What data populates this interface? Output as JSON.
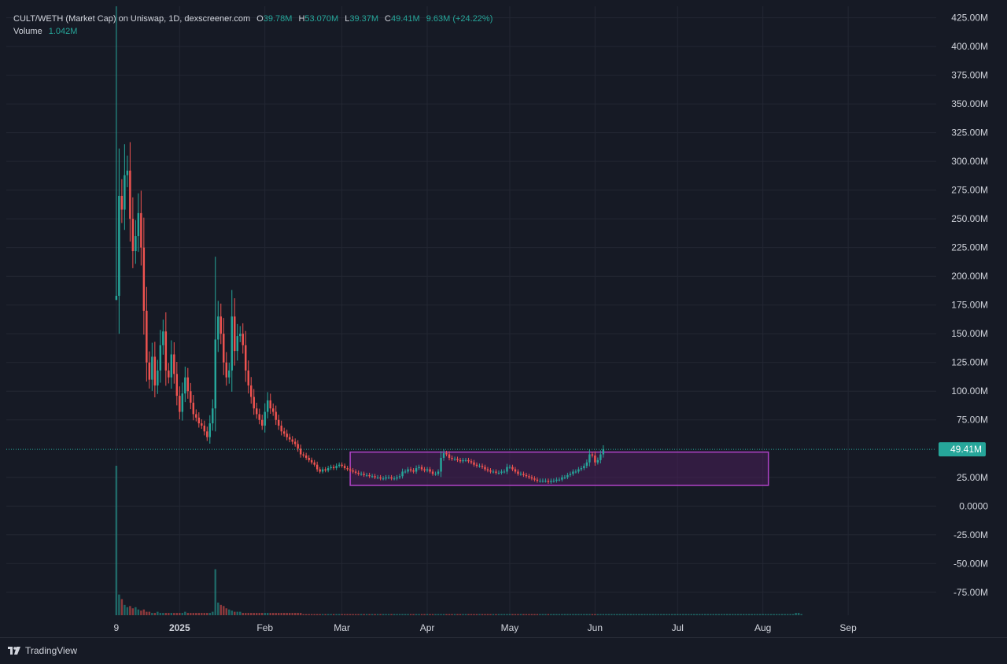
{
  "legend": {
    "title": "CULT/WETH (Market Cap) on Uniswap, 1D, dexscreener.com",
    "o_label": "O",
    "o_value": "39.78M",
    "h_label": "H",
    "h_value": "53.070M",
    "l_label": "L",
    "l_value": "39.37M",
    "c_label": "C",
    "c_value": "49.41M",
    "change": "9.63M (+24.22%)",
    "volume_label": "Volume",
    "volume_value": "1.042M"
  },
  "brand": "TradingView",
  "colors": {
    "background": "#161a25",
    "grid": "#232733",
    "up": "#26a69a",
    "down": "#ef5350",
    "box_fill": "#4a1f5a",
    "box_stroke": "#b042c6",
    "price_line": "#26a69a"
  },
  "chart_data": {
    "type": "candlestick",
    "timeframe": "1D",
    "y_unit": "market cap (USD)",
    "ylim": [
      -95,
      435
    ],
    "y_ticks": [
      {
        "v": 425,
        "label": "425.00M"
      },
      {
        "v": 400,
        "label": "400.00M"
      },
      {
        "v": 375,
        "label": "375.00M"
      },
      {
        "v": 350,
        "label": "350.00M"
      },
      {
        "v": 325,
        "label": "325.00M"
      },
      {
        "v": 300,
        "label": "300.00M"
      },
      {
        "v": 275,
        "label": "275.00M"
      },
      {
        "v": 250,
        "label": "250.00M"
      },
      {
        "v": 225,
        "label": "225.00M"
      },
      {
        "v": 200,
        "label": "200.00M"
      },
      {
        "v": 175,
        "label": "175.00M"
      },
      {
        "v": 150,
        "label": "150.00M"
      },
      {
        "v": 125,
        "label": "125.00M"
      },
      {
        "v": 100,
        "label": "100.00M"
      },
      {
        "v": 75,
        "label": "75.00M"
      },
      {
        "v": 25,
        "label": "25.00M"
      },
      {
        "v": 0,
        "label": "0.0000"
      },
      {
        "v": -25,
        "label": "-25.00M"
      },
      {
        "v": -50,
        "label": "-50.00M"
      },
      {
        "v": -75,
        "label": "-75.00M"
      }
    ],
    "x_ticks": [
      {
        "day": 0,
        "label": "9"
      },
      {
        "day": 23,
        "label": "2025"
      },
      {
        "day": 54,
        "label": "Feb"
      },
      {
        "day": 82,
        "label": "Mar"
      },
      {
        "day": 113,
        "label": "Apr"
      },
      {
        "day": 143,
        "label": "May"
      },
      {
        "day": 174,
        "label": "Jun"
      },
      {
        "day": 204,
        "label": "Jul"
      },
      {
        "day": 235,
        "label": "Aug"
      },
      {
        "day": 266,
        "label": "Sep"
      }
    ],
    "x_range_days": [
      -40,
      298
    ],
    "last_price": 49.41,
    "last_price_label": "49.41M",
    "range_box": {
      "day_start": 85,
      "day_end": 237,
      "y_low": 18,
      "y_high": 47
    },
    "series_closes": [
      183,
      270,
      258,
      288,
      292,
      250,
      222,
      235,
      255,
      225,
      170,
      125,
      110,
      130,
      105,
      118,
      140,
      152,
      118,
      112,
      132,
      115,
      96,
      82,
      98,
      112,
      100,
      90,
      80,
      77,
      72,
      70,
      65,
      60,
      72,
      85,
      145,
      165,
      150,
      125,
      112,
      118,
      165,
      135,
      148,
      150,
      140,
      118,
      105,
      95,
      85,
      80,
      75,
      70,
      82,
      92,
      85,
      82,
      75,
      70,
      65,
      63,
      60,
      58,
      56,
      54,
      50,
      45,
      44,
      42,
      40,
      38,
      36,
      32,
      30,
      32,
      31,
      33,
      34,
      33,
      35,
      36,
      35,
      33,
      32,
      31,
      30,
      29,
      28,
      28,
      27,
      27,
      26,
      26,
      25,
      25,
      24,
      24,
      25,
      25,
      24,
      24,
      25,
      26,
      30,
      30,
      32,
      31,
      30,
      33,
      34,
      32,
      31,
      32,
      30,
      28,
      28,
      30,
      42,
      46,
      45,
      42,
      41,
      41,
      40,
      39,
      40,
      40,
      39,
      38,
      36,
      35,
      35,
      34,
      32,
      31,
      30,
      30,
      29,
      29,
      30,
      30,
      34,
      34,
      32,
      30,
      28,
      28,
      27,
      26,
      25,
      24,
      23,
      22,
      22,
      22,
      22,
      21,
      22,
      22,
      23,
      23,
      25,
      25,
      27,
      28,
      30,
      30,
      32,
      33,
      35,
      38,
      45,
      44,
      38,
      40,
      45,
      49.41
    ],
    "volume_unit": "USD",
    "volume_ylim": [
      0,
      130
    ],
    "volumes": [
      130,
      18,
      14,
      9,
      7,
      8,
      6,
      7,
      5,
      4,
      5,
      3,
      3,
      2,
      2,
      3,
      2,
      2,
      2,
      2,
      2,
      2,
      2,
      2,
      2,
      3,
      2,
      2,
      2,
      2,
      2,
      2,
      2,
      2,
      2,
      3,
      40,
      11,
      9,
      8,
      6,
      5,
      4,
      3,
      3,
      3,
      2,
      2,
      2,
      2,
      2,
      2,
      2,
      2,
      2,
      2,
      2,
      2,
      2,
      2,
      2,
      2,
      2,
      2,
      2,
      2,
      2,
      2,
      1,
      1,
      1,
      1,
      1,
      1,
      1,
      1,
      1,
      1,
      1,
      1,
      1,
      1,
      1,
      1,
      1,
      1,
      1,
      1,
      1,
      1,
      1,
      1,
      1,
      1,
      1,
      1,
      1,
      1,
      1,
      1,
      1,
      1,
      1,
      1,
      1,
      1,
      1,
      1,
      1,
      1,
      1,
      1,
      1,
      1,
      1,
      1,
      1,
      1,
      1,
      1,
      1,
      1,
      1,
      1,
      1,
      1,
      1,
      1,
      1,
      1,
      1,
      1,
      1,
      1,
      1,
      1,
      1,
      1,
      1,
      1,
      1,
      1,
      1,
      1,
      1,
      1,
      1,
      1,
      1,
      1,
      1,
      1,
      1,
      1,
      1,
      1,
      1,
      1,
      1,
      1,
      1,
      1,
      1,
      1,
      1,
      1,
      1,
      1,
      1,
      1,
      1,
      1,
      1,
      1,
      1,
      1,
      1,
      1,
      1,
      1,
      1,
      1,
      1,
      1,
      1,
      1,
      1,
      1,
      1,
      1,
      1,
      1,
      1,
      1,
      1,
      1,
      1,
      1,
      1,
      1,
      1,
      1,
      1,
      1,
      1,
      1,
      1,
      1,
      1,
      1,
      1,
      1,
      1,
      1,
      1,
      1,
      1,
      1,
      1,
      1,
      1,
      1,
      1,
      1,
      1,
      1,
      1,
      1,
      1,
      1,
      1,
      1,
      1,
      1,
      1,
      1,
      1,
      1,
      1,
      1,
      1,
      1,
      1,
      1,
      1,
      1,
      1,
      2,
      2,
      1
    ]
  }
}
